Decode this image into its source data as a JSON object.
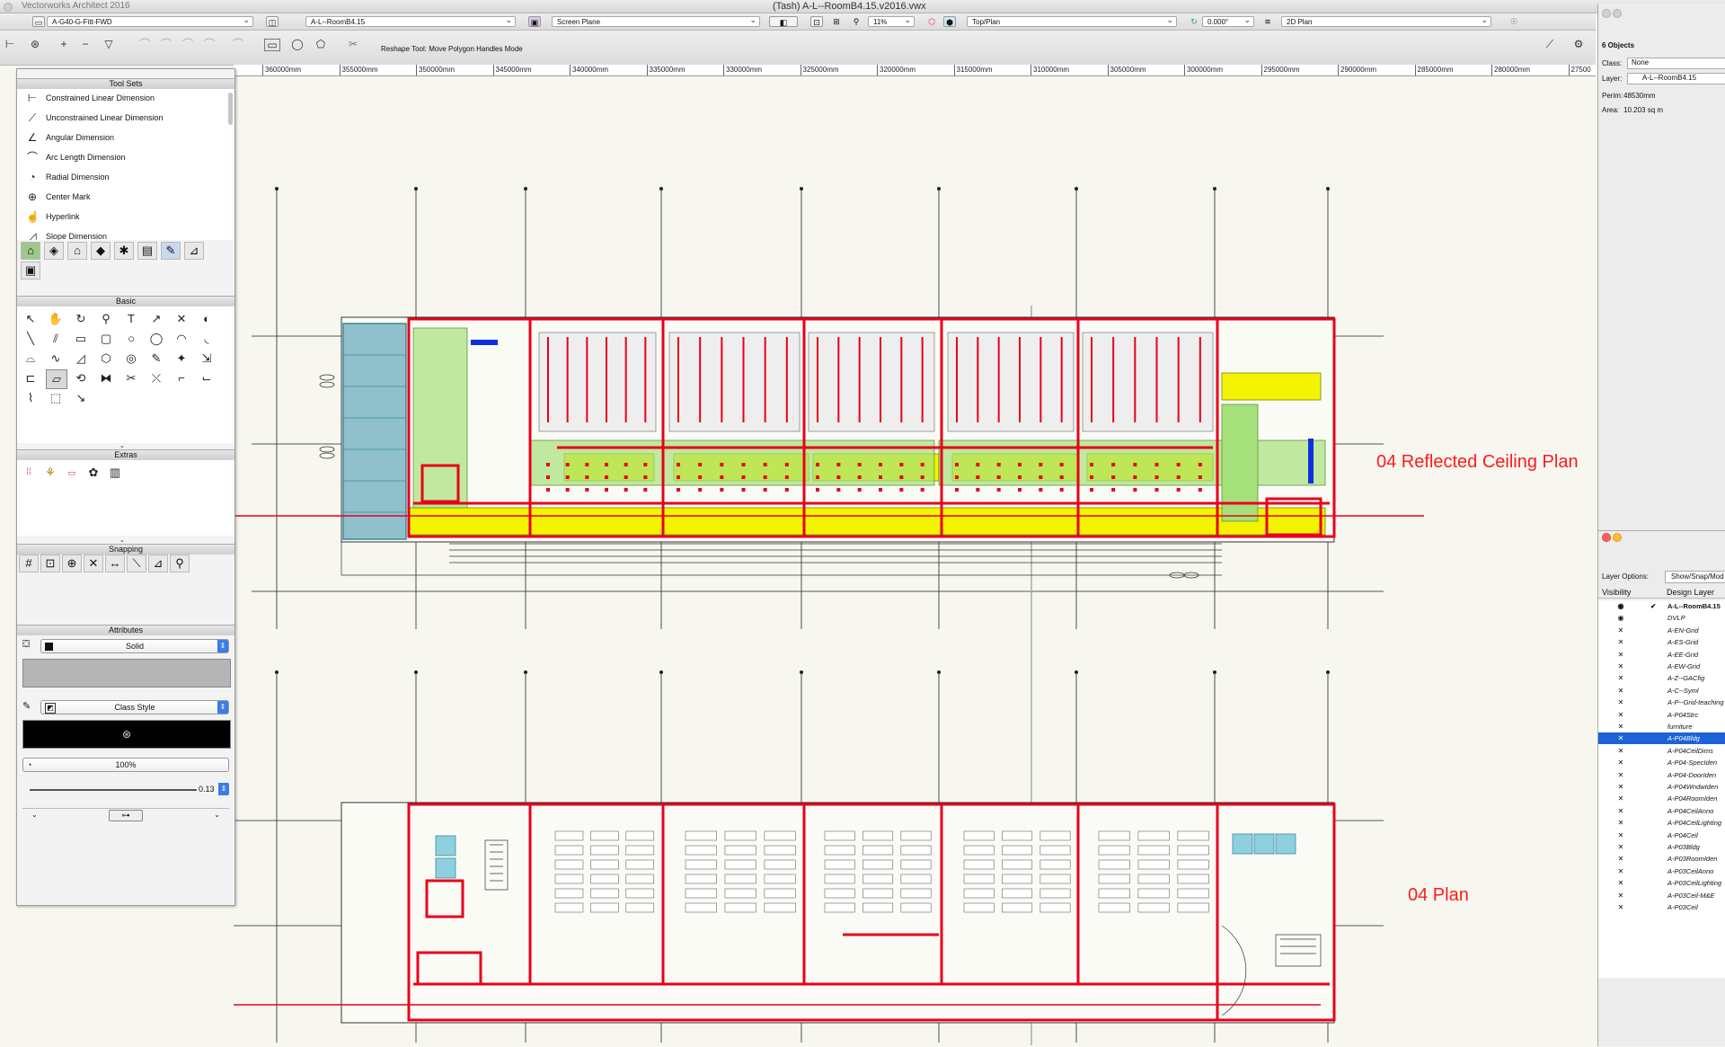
{
  "window": {
    "app_name": "Vectorworks Architect 2016",
    "doc_title": "(Tash) A-L--RoomB4.15.v2016.vwx"
  },
  "view_bar": {
    "class_select": "A-G40-G-Fitt-FWD",
    "layer_select": "A-L--RoomB4.15",
    "plane_select": "Screen Plane",
    "zoom": "11%",
    "view_select": "Top/Plan",
    "rotation": "0.000°",
    "render_select": "2D Plan"
  },
  "mode_bar": {
    "mode_text": "Reshape Tool: Move Polygon Handles Mode"
  },
  "ruler": {
    "ticks": [
      "360000mm",
      "355000mm",
      "350000mm",
      "345000mm",
      "340000mm",
      "335000mm",
      "330000mm",
      "325000mm",
      "320000mm",
      "315000mm",
      "310000mm",
      "305000mm",
      "300000mm",
      "295000mm",
      "290000mm",
      "285000mm",
      "280000mm",
      "27500"
    ]
  },
  "tool_sets": {
    "title": "Tool Sets",
    "items": [
      {
        "label": "Constrained Linear Dimension",
        "icon": "linear-dim"
      },
      {
        "label": "Unconstrained Linear Dimension",
        "icon": "unconstrained-dim"
      },
      {
        "label": "Angular Dimension",
        "icon": "angular-dim"
      },
      {
        "label": "Arc Length Dimension",
        "icon": "arc-dim"
      },
      {
        "label": "Radial Dimension",
        "icon": "radial-dim"
      },
      {
        "label": "Center Mark",
        "icon": "center-mark"
      },
      {
        "label": "Hyperlink",
        "icon": "hyperlink"
      },
      {
        "label": "Slope Dimension",
        "icon": "slope-dim"
      }
    ]
  },
  "basic": {
    "title": "Basic"
  },
  "extras": {
    "title": "Extras"
  },
  "snapping": {
    "title": "Snapping"
  },
  "attributes": {
    "title": "Attributes",
    "fill_style": "Solid",
    "pen_style": "Class Style",
    "opacity": "100%",
    "line_weight": "0.13",
    "colors": {
      "fill": "#b5b5b5",
      "pen": "#000000"
    }
  },
  "object_info": {
    "count": "6 Objects",
    "class_label": "Class:",
    "class_value": "None",
    "layer_label": "Layer:",
    "layer_value": "A-L--RoomB4.15",
    "perim_label": "Perim:",
    "perim_value": "48530mm",
    "area_label": "Area:",
    "area_value": "10.203 sq m"
  },
  "navigation": {
    "layer_options_label": "Layer Options:",
    "layer_options_value": "Show/Snap/Mod",
    "col_visibility": "Visibility",
    "col_design_layer": "Design Layer",
    "layers": [
      {
        "name": "A-L--RoomB4.15",
        "vis": "eye",
        "active": true
      },
      {
        "name": "DVLP",
        "vis": "eye"
      },
      {
        "name": "A-EN-Grid",
        "vis": "x"
      },
      {
        "name": "A-ES-Grid",
        "vis": "x"
      },
      {
        "name": "A-EE-Grid",
        "vis": "x"
      },
      {
        "name": "A-EW-Grid",
        "vis": "x"
      },
      {
        "name": "A-Z--GACfig",
        "vis": "x"
      },
      {
        "name": "A-C--Syml",
        "vis": "x"
      },
      {
        "name": "A-P--Grid-teaching",
        "vis": "x"
      },
      {
        "name": "A-P04Strc",
        "vis": "x"
      },
      {
        "name": "furniture",
        "vis": "x"
      },
      {
        "name": "A-P04Bldg",
        "vis": "x",
        "selected": true
      },
      {
        "name": "A-P04CeilDims",
        "vis": "x"
      },
      {
        "name": "A-P04-SpecIden",
        "vis": "x"
      },
      {
        "name": "A-P04-DoorIden",
        "vis": "x"
      },
      {
        "name": "A-P04WndwIden",
        "vis": "x"
      },
      {
        "name": "A-P04RoomIden",
        "vis": "x"
      },
      {
        "name": "A-P04CeilAnno",
        "vis": "x"
      },
      {
        "name": "A-P04CeilLighting",
        "vis": "x"
      },
      {
        "name": "A-P04Ceil",
        "vis": "x"
      },
      {
        "name": "A-P03Bldg",
        "vis": "x"
      },
      {
        "name": "A-P03RoomIden",
        "vis": "x"
      },
      {
        "name": "A-P03CeilAnno",
        "vis": "x"
      },
      {
        "name": "A-P03CeilLighting",
        "vis": "x"
      },
      {
        "name": "A-P03Ceil-M&E",
        "vis": "x"
      },
      {
        "name": "A-P03Ceil",
        "vis": "x"
      }
    ]
  },
  "drawing": {
    "label_rcp": "04 Reflected Ceiling Plan",
    "label_plan": "04 Plan",
    "colors": {
      "wall": "#e8001c",
      "ceiling_yellow": "#f4f400",
      "ceiling_green": "#a6e07a",
      "glass": "#5aa6b8"
    }
  }
}
